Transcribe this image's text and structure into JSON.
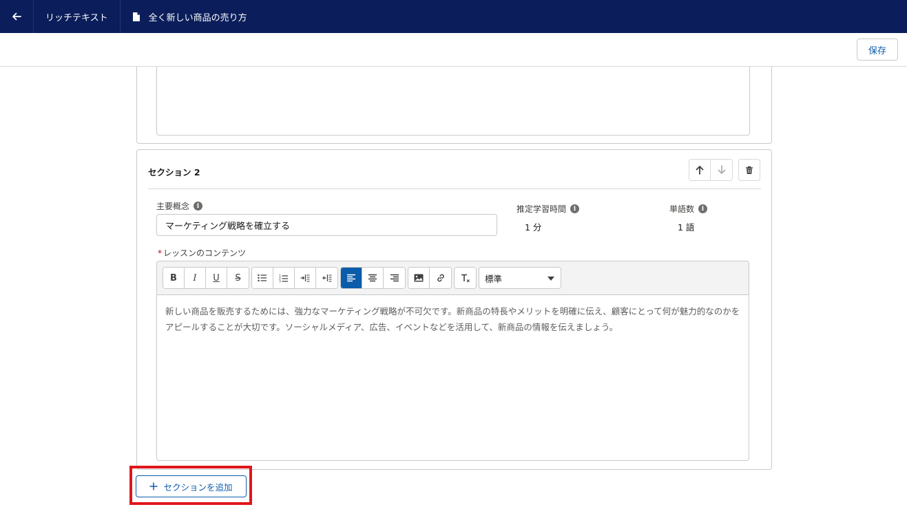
{
  "nav": {
    "breadcrumb": "リッチテキスト",
    "document_title": "全く新しい商品の売り方"
  },
  "actions": {
    "save_label": "保存"
  },
  "section": {
    "title": "セクション 2",
    "key_concept_label": "主要概念",
    "key_concept_value": "マーケティング戦略を確立する",
    "est_time_label": "推定学習時間",
    "est_time_value": "1 分",
    "word_count_label": "単語数",
    "word_count_value": "1 語",
    "content_label": "レッスンのコンテンツ",
    "required_marker": "*",
    "format_select": "標準",
    "content_text": "新しい商品を販売するためには、強力なマーケティング戦略が不可欠です。新商品の特長やメリットを明確に伝え、顧客にとって何が魅力的なのかをアピールすることが大切です。ソーシャルメディア、広告、イベントなどを活用して、新商品の情報を伝えましょう。"
  },
  "toolbar_buttons": {
    "bold": "B",
    "italic": "I",
    "underline": "U",
    "strike": "S"
  },
  "add_section": {
    "label": "セクションを追加"
  },
  "colors": {
    "nav_bg": "#0b1e5b",
    "accent": "#0b5cab",
    "highlight": "#e0161b"
  }
}
